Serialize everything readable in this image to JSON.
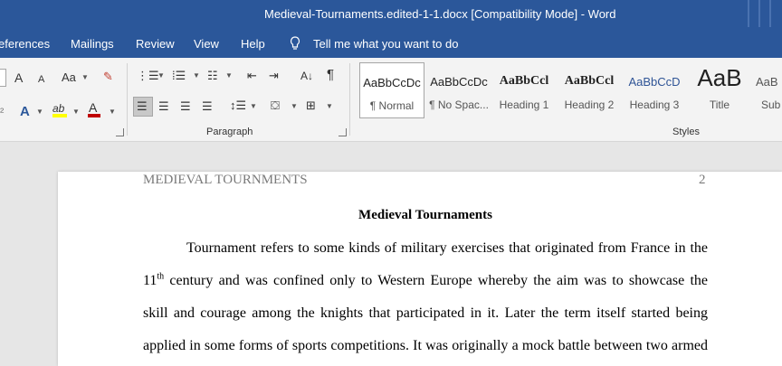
{
  "window": {
    "title": "Medieval-Tournaments.edited-1-1.docx [Compatibility Mode]  -  Word"
  },
  "menu": {
    "items": [
      "eferences",
      "Mailings",
      "Review",
      "View",
      "Help"
    ],
    "tell_me": "Tell me what you want to do"
  },
  "ribbon": {
    "paragraph_label": "Paragraph",
    "styles_label": "Styles",
    "styles": [
      {
        "preview": "AaBbCcDc",
        "name": "¶ Normal"
      },
      {
        "preview": "AaBbCcDc",
        "name": "¶ No Spac..."
      },
      {
        "preview": "AaBbCcl",
        "name": "Heading 1"
      },
      {
        "preview": "AaBbCcl",
        "name": "Heading 2"
      },
      {
        "preview": "AaBbCcD",
        "name": "Heading 3"
      },
      {
        "preview": "AaB",
        "name": "Title"
      },
      {
        "preview": "AaB",
        "name": "Sub"
      }
    ],
    "icons": {
      "font_grow": "A",
      "font_shrink": "A",
      "change_case": "Aa",
      "pilcrow": "¶",
      "text_effects": "A",
      "highlight": "ab",
      "font_color": "A"
    }
  },
  "document": {
    "header_left": "MEDIEVAL TOURNMENTS",
    "header_right": "2",
    "title": "Medieval Tournaments",
    "line1": "Tournament refers to some kinds of military exercises that originated from France in the",
    "line2_num": "11",
    "line2_sup": "th",
    "line2_rest": " century and was confined only to Western Europe whereby the aim was to showcase the",
    "line3": "skill and courage among the knights that participated in it. Later the term itself started being",
    "line4": "applied in some forms of sports competitions. It was originally a mock battle between two armed"
  },
  "colors": {
    "title_bar": "#2b579a",
    "highlight": "#ffff00",
    "font_color": "#c00000"
  }
}
